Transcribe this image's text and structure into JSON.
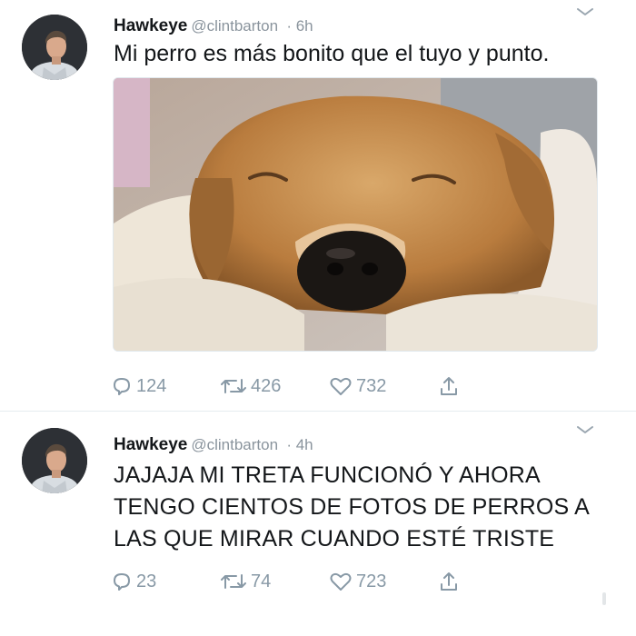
{
  "tweets": [
    {
      "name": "Hawkeye",
      "handle": "@clintbarton",
      "time": "· 6h",
      "text": "Mi perro es más bonito que el tuyo y punto.",
      "replies": "124",
      "retweets": "426",
      "likes": "732"
    },
    {
      "name": "Hawkeye",
      "handle": "@clintbarton",
      "time": "· 4h",
      "text": "JAJAJA MI TRETA FUNCIONÓ Y AHORA TENGO CIENTOS DE FOTOS DE PERROS A LAS QUE MIRAR CUANDO ESTÉ TRISTE",
      "replies": "23",
      "retweets": "74",
      "likes": "723"
    }
  ],
  "colors": {
    "text": "#14171a",
    "muted": "#8899a6",
    "divider": "#e6ecf0"
  }
}
